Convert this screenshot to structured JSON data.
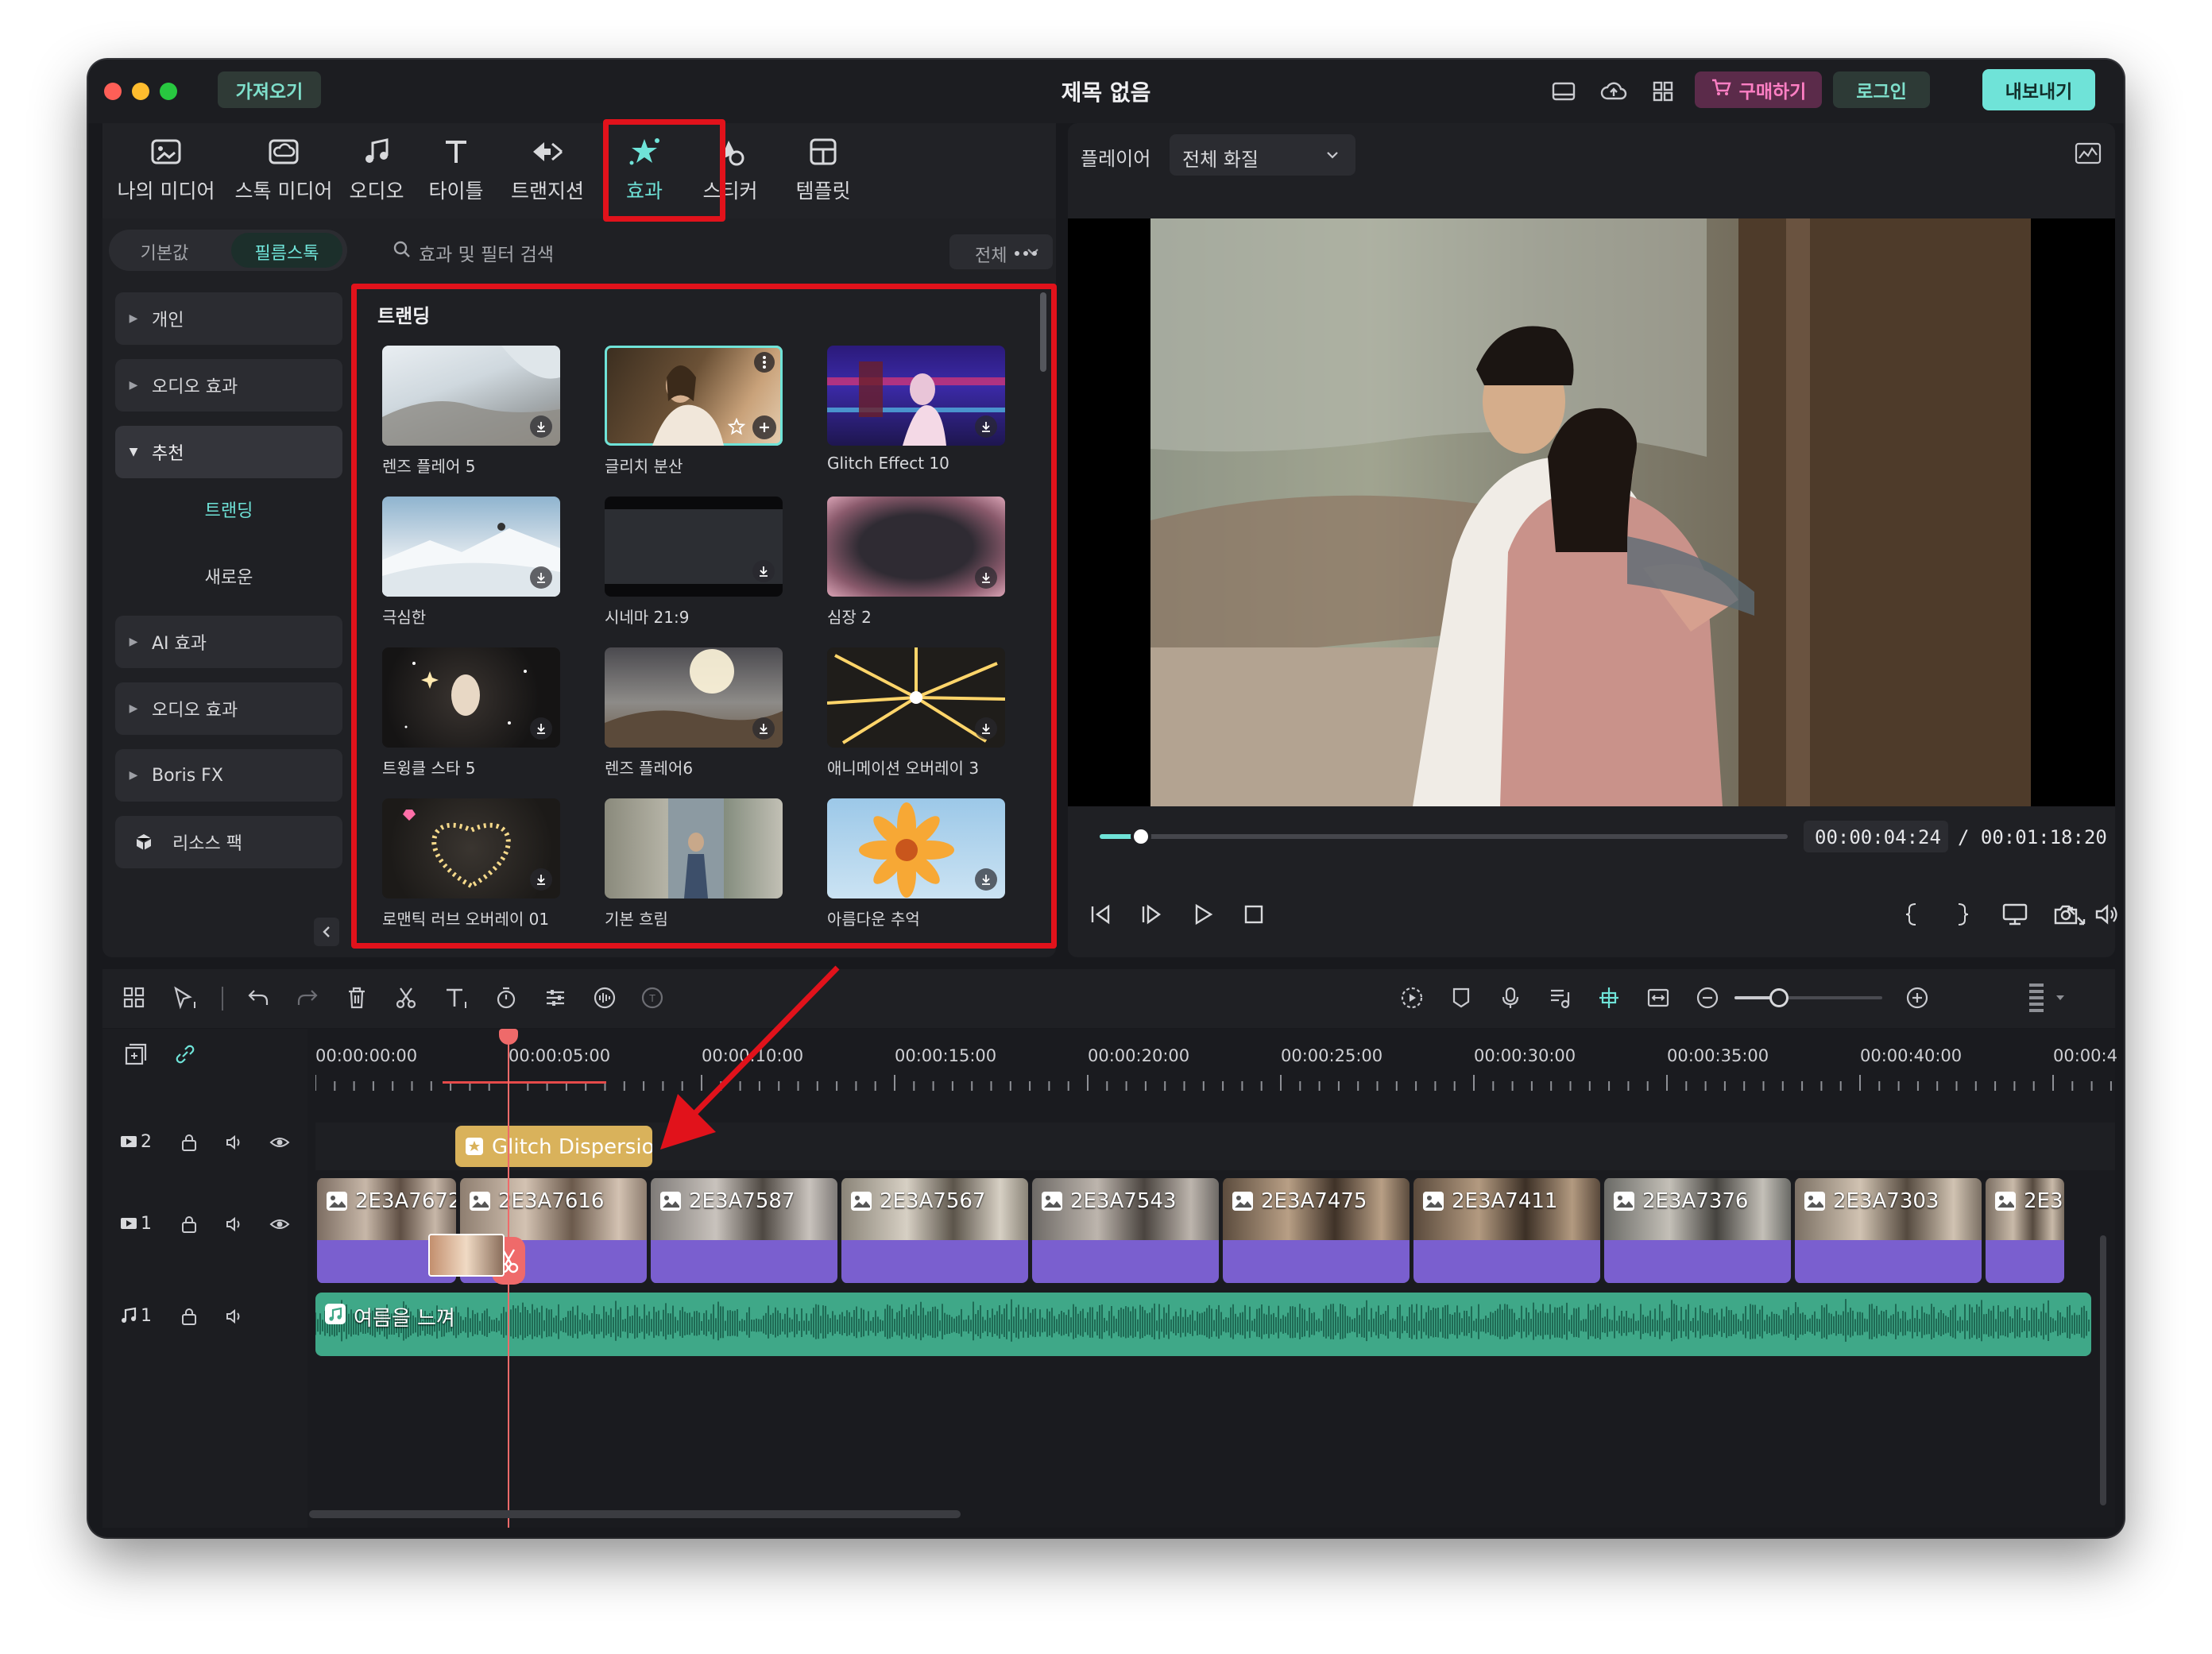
{
  "window": {
    "title": "제목 없음",
    "import_label": "가져오기",
    "buy_label": "구매하기",
    "login_label": "로그인",
    "export_label": "내보내기"
  },
  "toolbar": {
    "tabs": [
      {
        "label": "나의 미디어",
        "icon": "my-media-icon"
      },
      {
        "label": "스톡 미디어",
        "icon": "stock-media-icon"
      },
      {
        "label": "오디오",
        "icon": "music-note-icon"
      },
      {
        "label": "타이틀",
        "icon": "title-text-icon"
      },
      {
        "label": "트랜지션",
        "icon": "transition-icon"
      },
      {
        "label": "효과",
        "icon": "effects-star-icon",
        "active": true
      },
      {
        "label": "스티커",
        "icon": "sticker-icon"
      },
      {
        "label": "템플릿",
        "icon": "template-icon"
      }
    ]
  },
  "library": {
    "segment": [
      "기본값",
      "필름스톡"
    ],
    "segment_active": 1,
    "search_placeholder": "효과 및 필터 검색",
    "filter_value": "전체",
    "categories": [
      {
        "label": "개인",
        "expanded": false
      },
      {
        "label": "오디오 효과",
        "expanded": false
      },
      {
        "label": "추천",
        "expanded": true
      },
      {
        "label": "트랜딩",
        "sub": true,
        "active": true
      },
      {
        "label": "새로운",
        "sub": true
      },
      {
        "label": "AI 효과",
        "expanded": false
      },
      {
        "label": "오디오 효과",
        "expanded": false
      },
      {
        "label": "Boris FX",
        "expanded": false
      },
      {
        "label": "리소스 팩",
        "icon": "resource-pack-icon"
      }
    ],
    "section_title": "트랜딩",
    "effects": [
      {
        "label": "렌즈 플레어 5"
      },
      {
        "label": "글리치 분산",
        "selected": true
      },
      {
        "label": "Glitch Effect 10"
      },
      {
        "label": "극심한"
      },
      {
        "label": "시네마 21:9"
      },
      {
        "label": "심장 2"
      },
      {
        "label": "트윙클 스타 5"
      },
      {
        "label": "렌즈 플레어6"
      },
      {
        "label": "애니메이션 오버레이 3"
      },
      {
        "label": "로맨틱 러브 오버레이 01"
      },
      {
        "label": "기본 흐림"
      },
      {
        "label": "아름다운 추억"
      }
    ]
  },
  "player": {
    "label": "플레이어",
    "quality": "전체 화질",
    "current_time": "00:00:04:24",
    "total_time": "/ 00:01:18:20",
    "progress": 0.06
  },
  "timeline": {
    "ruler": [
      "00:00:00:00",
      "00:00:05:00",
      "00:00:10:00",
      "00:00:15:00",
      "00:00:20:00",
      "00:00:25:00",
      "00:00:30:00",
      "00:00:35:00",
      "00:00:40:00",
      "00:00:4"
    ],
    "tracks": [
      {
        "label": "2",
        "type": "video"
      },
      {
        "label": "1",
        "type": "video"
      },
      {
        "label": "1",
        "type": "audio"
      }
    ],
    "effect_clip": "Glitch Dispersio",
    "clips": [
      "2E3A7672",
      "2E3A7616",
      "2E3A7587",
      "2E3A7567",
      "2E3A7543",
      "2E3A7475",
      "2E3A7411",
      "2E3A7376",
      "2E3A7303",
      "2E3"
    ],
    "audio_clip": "여름을 느껴",
    "zoom_level": 0.3
  },
  "colors": {
    "accent": "#5ad6c4",
    "highlight_red": "#e1121b",
    "video_clip": "#7a5fcf",
    "audio_clip": "#3fa888",
    "effect_clip": "#d9b25b",
    "playhead": "#ef6a6a",
    "buy_bg": "#5b2b4a",
    "buy_text": "#ff7fc4"
  }
}
